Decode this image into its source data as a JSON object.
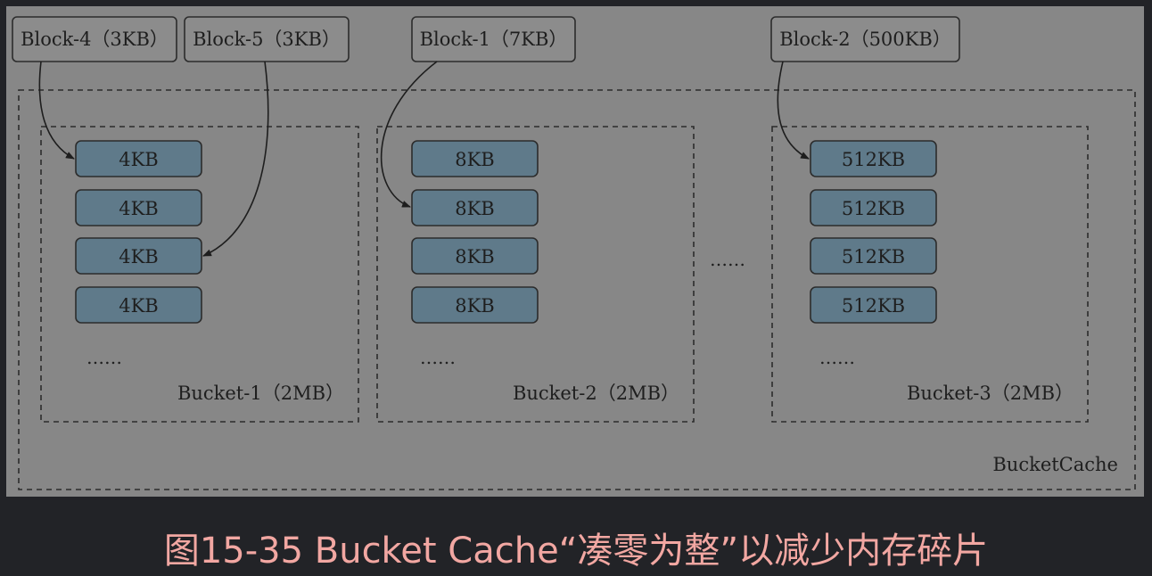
{
  "blocks": [
    {
      "label": "Block-4（3KB）"
    },
    {
      "label": "Block-5（3KB）"
    },
    {
      "label": "Block-1（7KB）"
    },
    {
      "label": "Block-2（500KB）"
    }
  ],
  "buckets": [
    {
      "label": "Bucket-1（2MB）",
      "slots": [
        "4KB",
        "4KB",
        "4KB",
        "4KB"
      ],
      "more": "……"
    },
    {
      "label": "Bucket-2（2MB）",
      "slots": [
        "8KB",
        "8KB",
        "8KB",
        "8KB"
      ],
      "more": "……"
    },
    {
      "label": "Bucket-3（2MB）",
      "slots": [
        "512KB",
        "512KB",
        "512KB",
        "512KB"
      ],
      "more": "……"
    }
  ],
  "between_ellipsis": "……",
  "container_label": "BucketCache",
  "caption": "图15-35 Bucket Cache“凑零为整”以减少内存碎片",
  "colors": {
    "panel": "#878787",
    "slot_fill": "#5f7a8a",
    "stroke": "#2c2c2c",
    "caption": "#f2a7a2",
    "background": "#222327"
  }
}
